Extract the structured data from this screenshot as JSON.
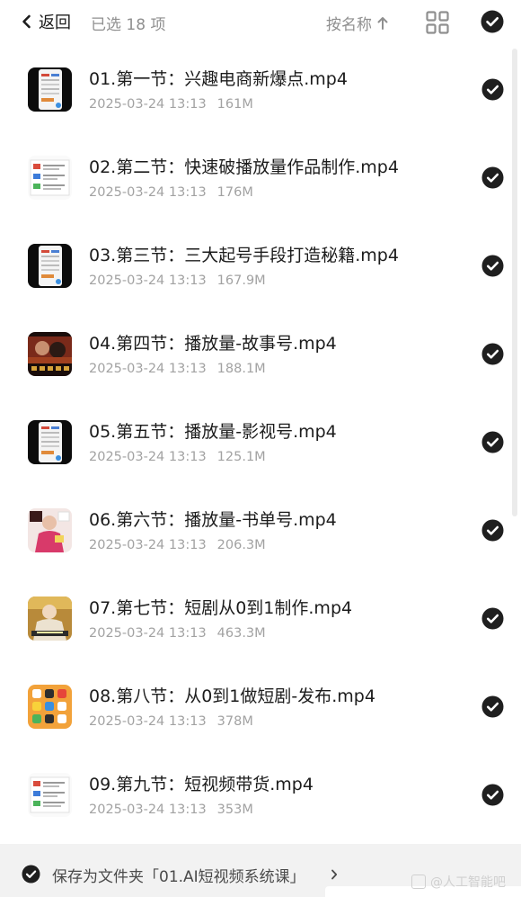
{
  "header": {
    "back_label": "返回",
    "selected_count": "已选 18 项",
    "sort_label": "按名称"
  },
  "files": [
    {
      "name": "01.第一节：兴趣电商新爆点.mp4",
      "date": "2025-03-24 13:13",
      "size": "161M",
      "thumb": "phone-dark"
    },
    {
      "name": "02.第二节：快速破播放量作品制作.mp4",
      "date": "2025-03-24 13:13",
      "size": "176M",
      "thumb": "document-light"
    },
    {
      "name": "03.第三节：三大起号手段打造秘籍.mp4",
      "date": "2025-03-24 13:13",
      "size": "167.9M",
      "thumb": "phone-dark"
    },
    {
      "name": "04.第四节：播放量-故事号.mp4",
      "date": "2025-03-24 13:13",
      "size": "188.1M",
      "thumb": "video-dark"
    },
    {
      "name": "05.第五节：播放量-影视号.mp4",
      "date": "2025-03-24 13:13",
      "size": "125.1M",
      "thumb": "phone-dark"
    },
    {
      "name": "06.第六节：播放量-书单号.mp4",
      "date": "2025-03-24 13:13",
      "size": "206.3M",
      "thumb": "portrait-pink"
    },
    {
      "name": "07.第七节：短剧从0到1制作.mp4",
      "date": "2025-03-24 13:13",
      "size": "463.3M",
      "thumb": "portrait-gold"
    },
    {
      "name": "08.第八节：从0到1做短剧-发布.mp4",
      "date": "2025-03-24 13:13",
      "size": "378M",
      "thumb": "app-grid-orange"
    },
    {
      "name": "09.第九节：短视频带货.mp4",
      "date": "2025-03-24 13:13",
      "size": "353M",
      "thumb": "document-light"
    }
  ],
  "footer": {
    "save_label": "保存为文件夹「01.AI短视频系统课」"
  },
  "watermark": "@人工智能吧",
  "colors": {
    "check": "#1f1f1f",
    "secondary_text": "#a2a2a2",
    "bottom_bar": "#f2f2f2"
  }
}
